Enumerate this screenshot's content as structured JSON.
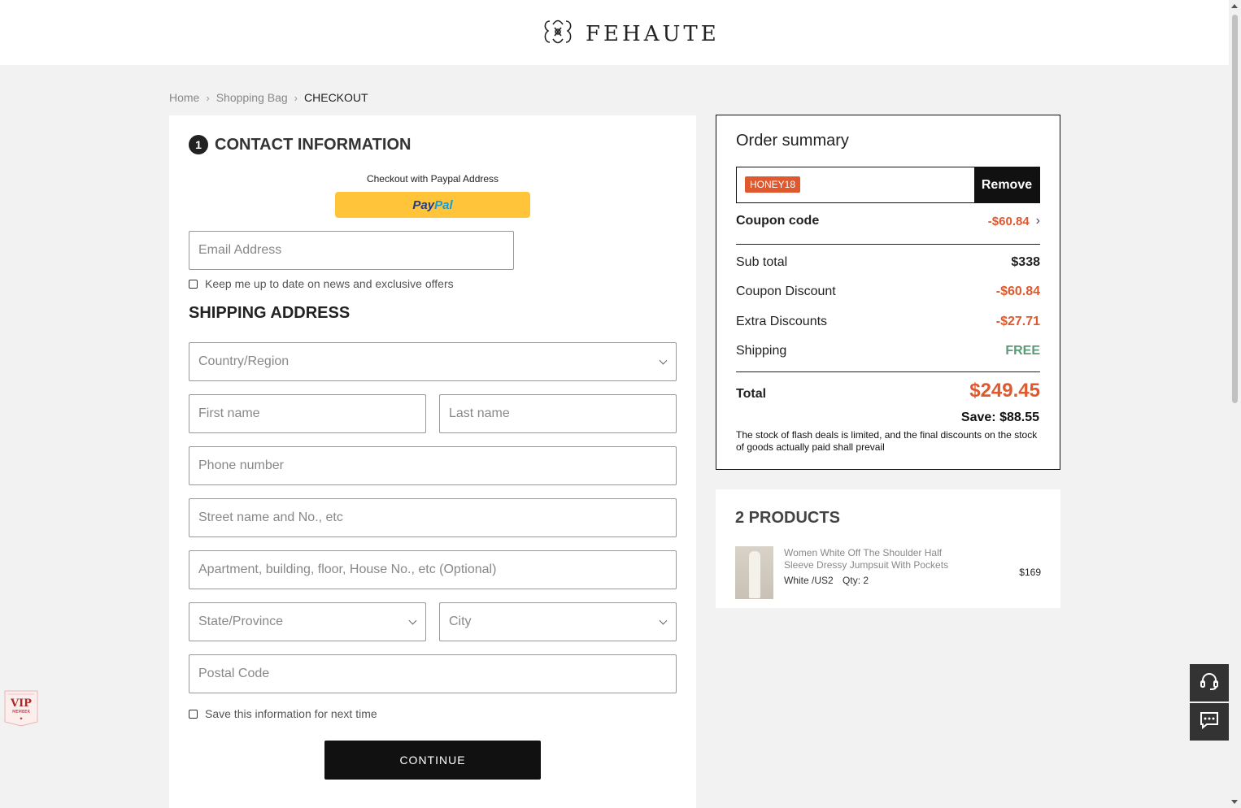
{
  "header": {
    "brand": "FEHAUTE",
    "logo_icon": "brand-monogram-icon"
  },
  "breadcrumb": {
    "home": "Home",
    "bag": "Shopping Bag",
    "current": "CHECKOUT"
  },
  "contact": {
    "step": "1",
    "title": "CONTACT INFORMATION",
    "paypal_label": "Checkout with Paypal Address",
    "paypal_pay": "Pay",
    "paypal_pal": "Pal",
    "email_placeholder": "Email Address",
    "newsletter_label": "Keep me up to date on news and exclusive offers"
  },
  "shipping": {
    "title": "SHIPPING ADDRESS",
    "country_placeholder": "Country/Region",
    "first_name_placeholder": "First name",
    "last_name_placeholder": "Last name",
    "phone_placeholder": "Phone number",
    "street_placeholder": "Street name and No., etc",
    "apartment_placeholder": "Apartment, building, floor, House No., etc (Optional)",
    "state_placeholder": "State/Province",
    "city_placeholder": "City",
    "postal_placeholder": "Postal Code",
    "save_info_label": "Save this information for next time",
    "continue_label": "CONTINUE"
  },
  "summary": {
    "title": "Order summary",
    "coupon_tag": "HONEY18",
    "remove_label": "Remove",
    "coupon_code_label": "Coupon code",
    "coupon_code_value": "-$60.84",
    "subtotal_label": "Sub total",
    "subtotal_value": "$338",
    "coupon_discount_label": "Coupon Discount",
    "coupon_discount_value": "-$60.84",
    "extra_discounts_label": "Extra Discounts",
    "extra_discounts_value": "-$27.71",
    "shipping_label": "Shipping",
    "shipping_value": "FREE",
    "total_label": "Total",
    "total_value": "$249.45",
    "save_text": "Save: $88.55",
    "notice": "The stock of flash deals is limited, and the final discounts on the stock of goods actually paid shall prevail"
  },
  "products": {
    "title": "2 PRODUCTS",
    "items": [
      {
        "name": "Women White Off The Shoulder Half Sleeve Dressy Jumpsuit With Pockets",
        "variant": "White /US2",
        "qty": "Qty: 2",
        "price": "$169"
      }
    ]
  },
  "floating": {
    "support_icon": "headset-icon",
    "chat_icon": "chat-icon",
    "vip_badge": "VIP MEMBER"
  },
  "colors": {
    "accent": "#e0582d",
    "free": "#5a9a78",
    "paypal": "#ffc439",
    "dark": "#111111"
  }
}
